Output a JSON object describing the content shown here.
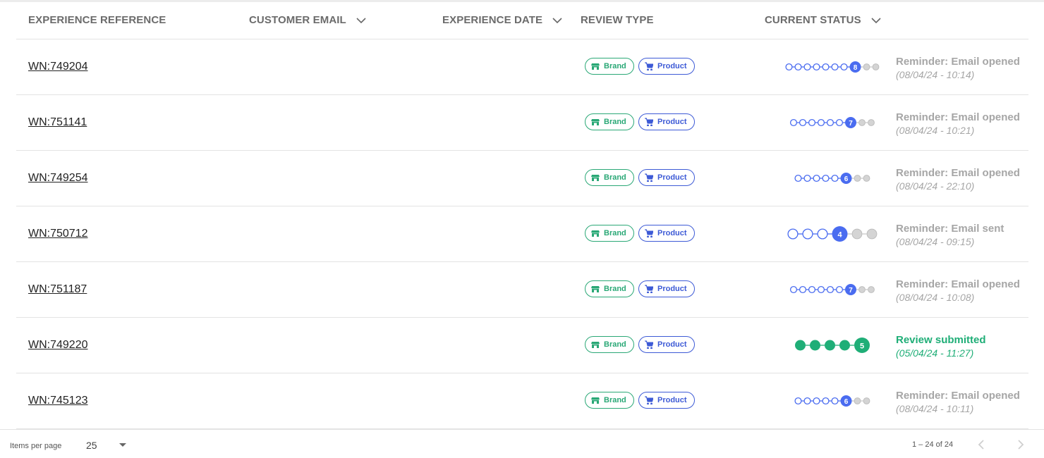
{
  "table": {
    "headers": [
      {
        "label": "EXPERIENCE REFERENCE",
        "sortable": false
      },
      {
        "label": "CUSTOMER EMAIL",
        "sortable": true
      },
      {
        "label": "EXPERIENCE DATE",
        "sortable": true
      },
      {
        "label": "REVIEW TYPE",
        "sortable": false
      },
      {
        "label": "CURRENT STATUS",
        "sortable": true
      }
    ],
    "rows": [
      {
        "ref": "WN:749204",
        "brand": "Brand",
        "product": "Product",
        "steps_total": 10,
        "current_step": 8,
        "status": "Reminder: Email opened",
        "timestamp": "(08/04/24 - 10:14)",
        "complete": false
      },
      {
        "ref": "WN:751141",
        "brand": "Brand",
        "product": "Product",
        "steps_total": 9,
        "current_step": 7,
        "status": "Reminder: Email opened",
        "timestamp": "(08/04/24 - 10:21)",
        "complete": false
      },
      {
        "ref": "WN:749254",
        "brand": "Brand",
        "product": "Product",
        "steps_total": 8,
        "current_step": 6,
        "status": "Reminder: Email opened",
        "timestamp": "(08/04/24 - 22:10)",
        "complete": false
      },
      {
        "ref": "WN:750712",
        "brand": "Brand",
        "product": "Product",
        "steps_total": 6,
        "current_step": 4,
        "status": "Reminder: Email sent",
        "timestamp": "(08/04/24 - 09:15)",
        "complete": false
      },
      {
        "ref": "WN:751187",
        "brand": "Brand",
        "product": "Product",
        "steps_total": 9,
        "current_step": 7,
        "status": "Reminder: Email opened",
        "timestamp": "(08/04/24 - 10:08)",
        "complete": false
      },
      {
        "ref": "WN:749220",
        "brand": "Brand",
        "product": "Product",
        "steps_total": 5,
        "current_step": 5,
        "status": "Review submitted",
        "timestamp": "(05/04/24 - 11:27)",
        "complete": true
      },
      {
        "ref": "WN:745123",
        "brand": "Brand",
        "product": "Product",
        "steps_total": 8,
        "current_step": 6,
        "status": "Reminder: Email opened",
        "timestamp": "(08/04/24 - 10:11)",
        "complete": false
      }
    ]
  },
  "footer": {
    "items_per_page_label": "Items per page",
    "items_per_page_value": "25",
    "range_label": "1 – 24 of 24"
  },
  "icons": {
    "sort": "chevron-down-icon",
    "brand": "store-icon",
    "product": "cart-icon",
    "prev": "chevron-left-icon",
    "next": "chevron-right-icon"
  },
  "colors": {
    "brand": "#2aa876",
    "product": "#3d5ad6",
    "step_active": "#4a6cf0",
    "step_done": "#1fae77",
    "step_pending": "#d4d4d4",
    "status_muted": "#a6a6a6"
  }
}
